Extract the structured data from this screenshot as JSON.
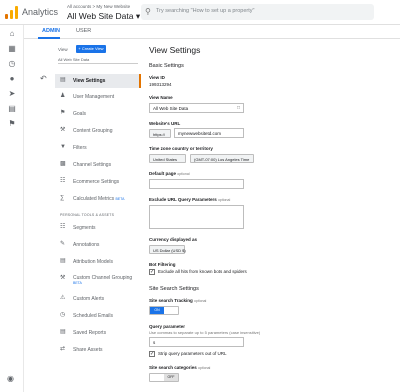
{
  "header": {
    "app_name": "Analytics",
    "breadcrumb": "All accounts > My New Website",
    "property": "All Web Site Data ▾",
    "search_placeholder": "Try searching \"How to set up a property\""
  },
  "tabs": {
    "admin": "ADMIN",
    "user": "USER"
  },
  "nav": {
    "view_label": "View",
    "create_view": "+ Create View",
    "view_select": "All Web Site Data",
    "items": [
      {
        "label": "View Settings",
        "icon": "file-icon"
      },
      {
        "label": "User Management",
        "icon": "users-icon"
      },
      {
        "label": "Goals",
        "icon": "flag-icon"
      },
      {
        "label": "Content Grouping",
        "icon": "tools-icon"
      },
      {
        "label": "Filters",
        "icon": "filter-icon"
      },
      {
        "label": "Channel Settings",
        "icon": "channel-icon"
      },
      {
        "label": "Ecommerce Settings",
        "icon": "cart-icon"
      },
      {
        "label": "Calculated Metrics",
        "badge": "BETA",
        "icon": "calc-icon"
      }
    ],
    "section_title": "PERSONAL TOOLS & ASSETS",
    "personal_items": [
      {
        "label": "Segments",
        "icon": "segments-icon"
      },
      {
        "label": "Annotations",
        "icon": "annotation-icon"
      },
      {
        "label": "Attribution Models",
        "icon": "bars-icon"
      },
      {
        "label": "Custom Channel Grouping",
        "badge": "BETA",
        "icon": "tools-icon"
      },
      {
        "label": "Custom Alerts",
        "icon": "alert-icon"
      },
      {
        "label": "Scheduled Emails",
        "icon": "clock-icon"
      },
      {
        "label": "Saved Reports",
        "icon": "document-icon"
      },
      {
        "label": "Share Assets",
        "icon": "share-icon"
      }
    ]
  },
  "main": {
    "title": "View Settings",
    "basic_settings": "Basic Settings",
    "view_id_label": "View ID",
    "view_id": "199313294",
    "view_name_label": "View Name",
    "view_name": "All Web Site Data",
    "website_url_label": "Website's URL",
    "protocol": "https://",
    "website_url": "mynewwebsitetd.com",
    "timezone_label": "Time zone country or territory",
    "country": "United States",
    "timezone": "(GMT-07:00) Los Angeles Time",
    "default_page_label": "Default page",
    "optional": "optional",
    "exclude_label": "Exclude URL Query Parameters",
    "currency_label": "Currency displayed as",
    "currency": "US Dollar (USD $)",
    "bot_label": "Bot Filtering",
    "bot_checkbox": "Exclude all hits from known bots and spiders",
    "site_search_header": "Site Search Settings",
    "site_search_tracking_label": "Site search Tracking",
    "toggle_on": "ON",
    "query_param_label": "Query parameter",
    "query_param_hint": "Use commas to separate up to 5 parameters (case insensitive)",
    "query_param_value": "s",
    "strip_label": "Strip query parameters out of URL",
    "categories_label": "Site search categories",
    "toggle_off": "OFF"
  }
}
